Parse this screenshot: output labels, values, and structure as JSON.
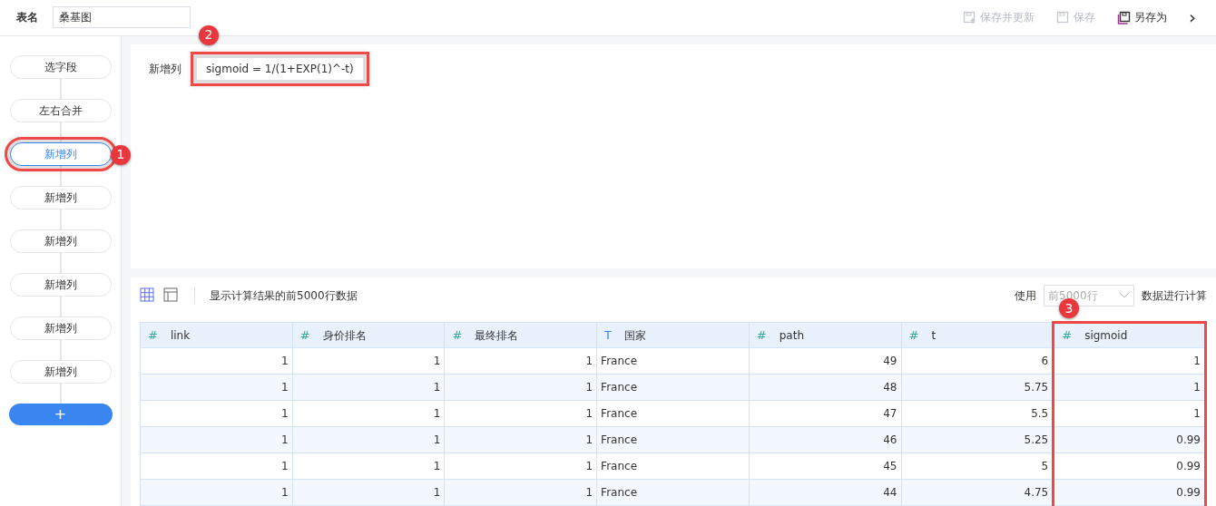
{
  "header": {
    "name_label": "表名",
    "name_value": "桑基图",
    "actions": [
      {
        "label": "保存并更新",
        "disabled": true,
        "kind": "update"
      },
      {
        "label": "保存",
        "disabled": true,
        "kind": "save"
      },
      {
        "label": "另存为",
        "disabled": false,
        "kind": "saveas"
      }
    ],
    "more": "›"
  },
  "steps": [
    {
      "label": "选字段",
      "selected": false,
      "highlighted": false
    },
    {
      "label": "左右合并",
      "selected": false,
      "highlighted": false
    },
    {
      "label": "新增列",
      "selected": true,
      "highlighted": true,
      "callout": "1"
    },
    {
      "label": "新增列",
      "selected": false,
      "highlighted": false
    },
    {
      "label": "新增列",
      "selected": false,
      "highlighted": false
    },
    {
      "label": "新增列",
      "selected": false,
      "highlighted": false
    },
    {
      "label": "新增列",
      "selected": false,
      "highlighted": false
    },
    {
      "label": "新增列",
      "selected": false,
      "highlighted": false
    }
  ],
  "add_step": "+",
  "editor": {
    "label": "新增列",
    "formula": "sigmoid = 1/(1+EXP(1)^-t)",
    "highlighted": true,
    "callout": "2"
  },
  "preview": {
    "note": "显示计算结果的前5000行数据",
    "use_label": "使用",
    "rows_select": "前5000行",
    "suffix": "数据进行计算",
    "views": [
      {
        "kind": "grid",
        "selected": true
      },
      {
        "kind": "panel",
        "selected": false
      }
    ]
  },
  "table": {
    "columns": [
      {
        "name": "link",
        "type": "#",
        "kind": "number",
        "highlighted": false
      },
      {
        "name": "身价排名",
        "type": "#",
        "kind": "number",
        "highlighted": false
      },
      {
        "name": "最终排名",
        "type": "#",
        "kind": "number",
        "highlighted": false
      },
      {
        "name": "国家",
        "type": "T",
        "kind": "text",
        "highlighted": false
      },
      {
        "name": "path",
        "type": "#",
        "kind": "number",
        "highlighted": false
      },
      {
        "name": "t",
        "type": "#",
        "kind": "number",
        "highlighted": false
      },
      {
        "name": "sigmoid",
        "type": "#",
        "kind": "number",
        "highlighted": true,
        "callout": "3"
      }
    ],
    "rows": [
      [
        "1",
        "1",
        "1",
        "France",
        "49",
        "6",
        "1"
      ],
      [
        "1",
        "1",
        "1",
        "France",
        "48",
        "5.75",
        "1"
      ],
      [
        "1",
        "1",
        "1",
        "France",
        "47",
        "5.5",
        "1"
      ],
      [
        "1",
        "1",
        "1",
        "France",
        "46",
        "5.25",
        "0.99"
      ],
      [
        "1",
        "1",
        "1",
        "France",
        "45",
        "5",
        "0.99"
      ],
      [
        "1",
        "1",
        "1",
        "France",
        "44",
        "4.75",
        "0.99"
      ]
    ]
  }
}
